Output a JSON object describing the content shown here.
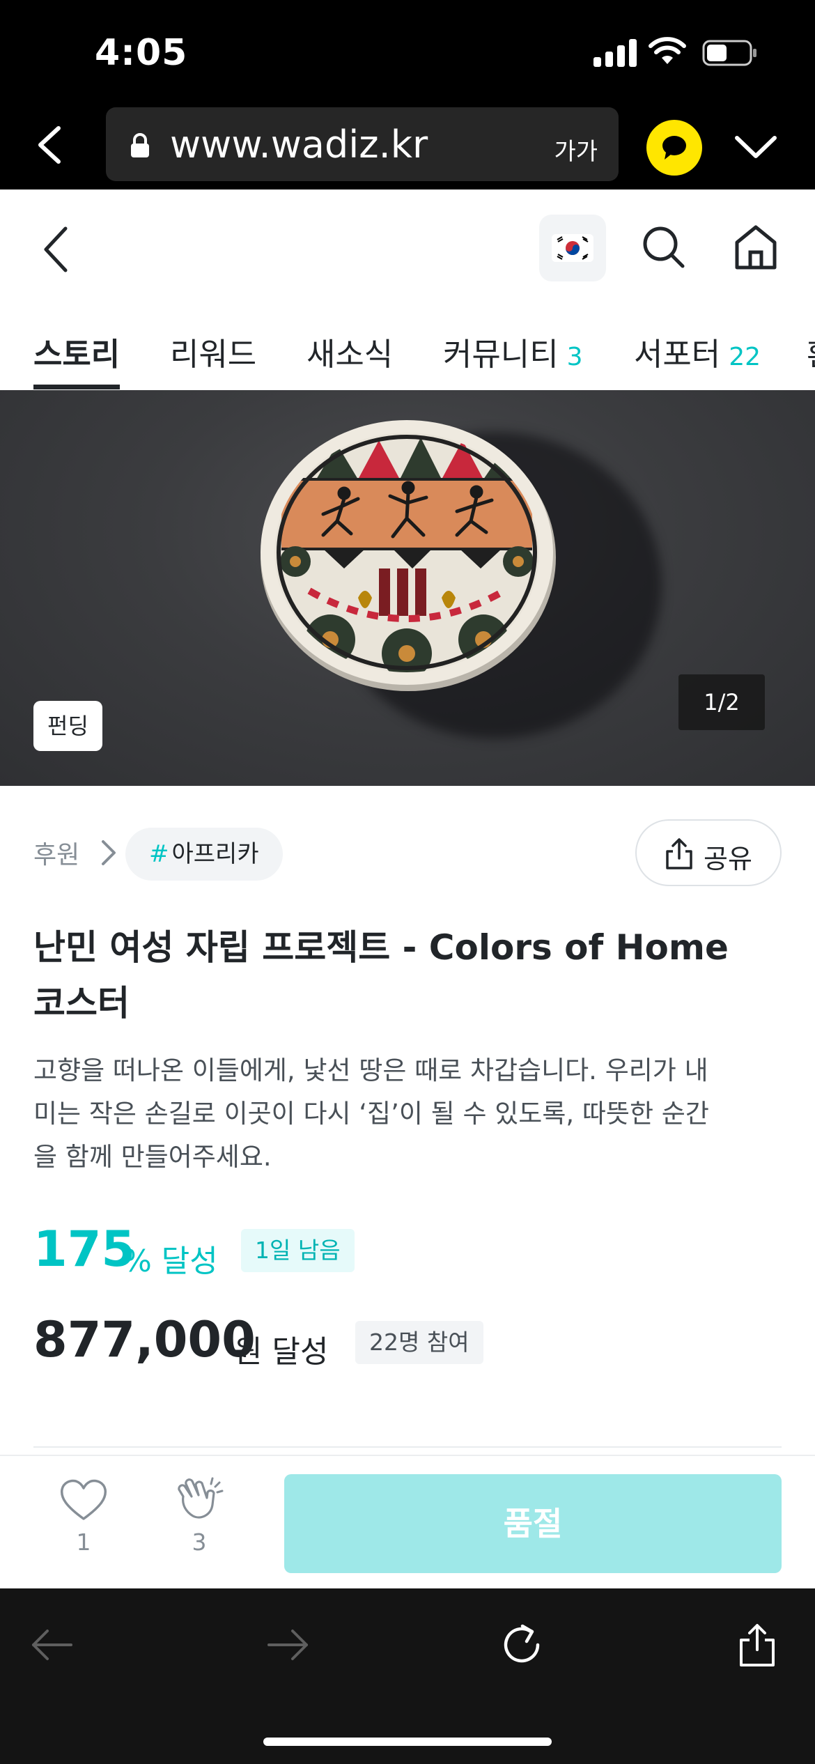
{
  "status_bar": {
    "time": "4:05"
  },
  "browser": {
    "url": "www.wadiz.kr",
    "text_size_label": "가가"
  },
  "tabs": [
    {
      "label": "스토리",
      "count": ""
    },
    {
      "label": "리워드",
      "count": ""
    },
    {
      "label": "새소식",
      "count": ""
    },
    {
      "label": "커뮤니티",
      "count": "3"
    },
    {
      "label": "서포터",
      "count": "22"
    },
    {
      "label": "환",
      "count": ""
    }
  ],
  "active_tab": "스토리",
  "hero": {
    "badge": "펀딩",
    "counter": "1/2"
  },
  "category": {
    "label": "후원",
    "tag_hash": "#",
    "tag": "아프리카",
    "share_label": "공유"
  },
  "project": {
    "title": "난민 여성 자립 프로젝트 - Colors of Home 코스터",
    "description": "고향을 떠나온 이들에게, 낯선 땅은 때로 차갑습니다. 우리가 내미는 작은 손길로 이곳이 다시 ‘집’이 될 수 있도록, 따뜻한 순간을 함께 만들어주세요."
  },
  "stats": {
    "percent": "175",
    "percent_unit": "% 달성",
    "days_left": "1일 남음",
    "amount": "877,000",
    "amount_unit": "원 달성",
    "participants": "22명 참여"
  },
  "actions": {
    "like_count": "1",
    "clap_count": "3",
    "main_button": "품절"
  },
  "colors": {
    "accent": "#00c4c4",
    "soldout_button": "#9ee8e8",
    "kakao_yellow": "#ffe600"
  }
}
